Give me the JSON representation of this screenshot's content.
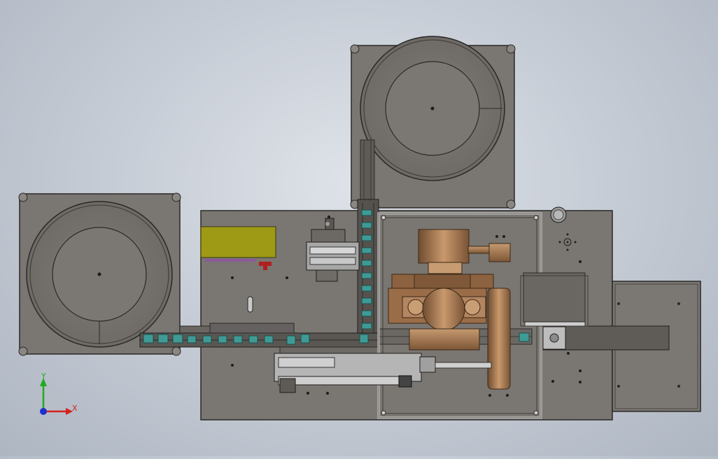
{
  "viewport": {
    "background_top": "#dfe3e9",
    "background_bottom": "#aeb6c2"
  },
  "colors": {
    "plate": "#7b7772",
    "plate_edge": "#2e2c2a",
    "bowl_face": "#7a7670",
    "bronze": "#b0845e",
    "bronze_dark": "#6e4c30",
    "teal": "#3f9a95",
    "label_yellow": "#9f9a15",
    "axis_x": "#d62020",
    "axis_y": "#22aa22",
    "axis_z": "#2030d0"
  },
  "triad": {
    "x_label": "X",
    "y_label": "Y"
  }
}
